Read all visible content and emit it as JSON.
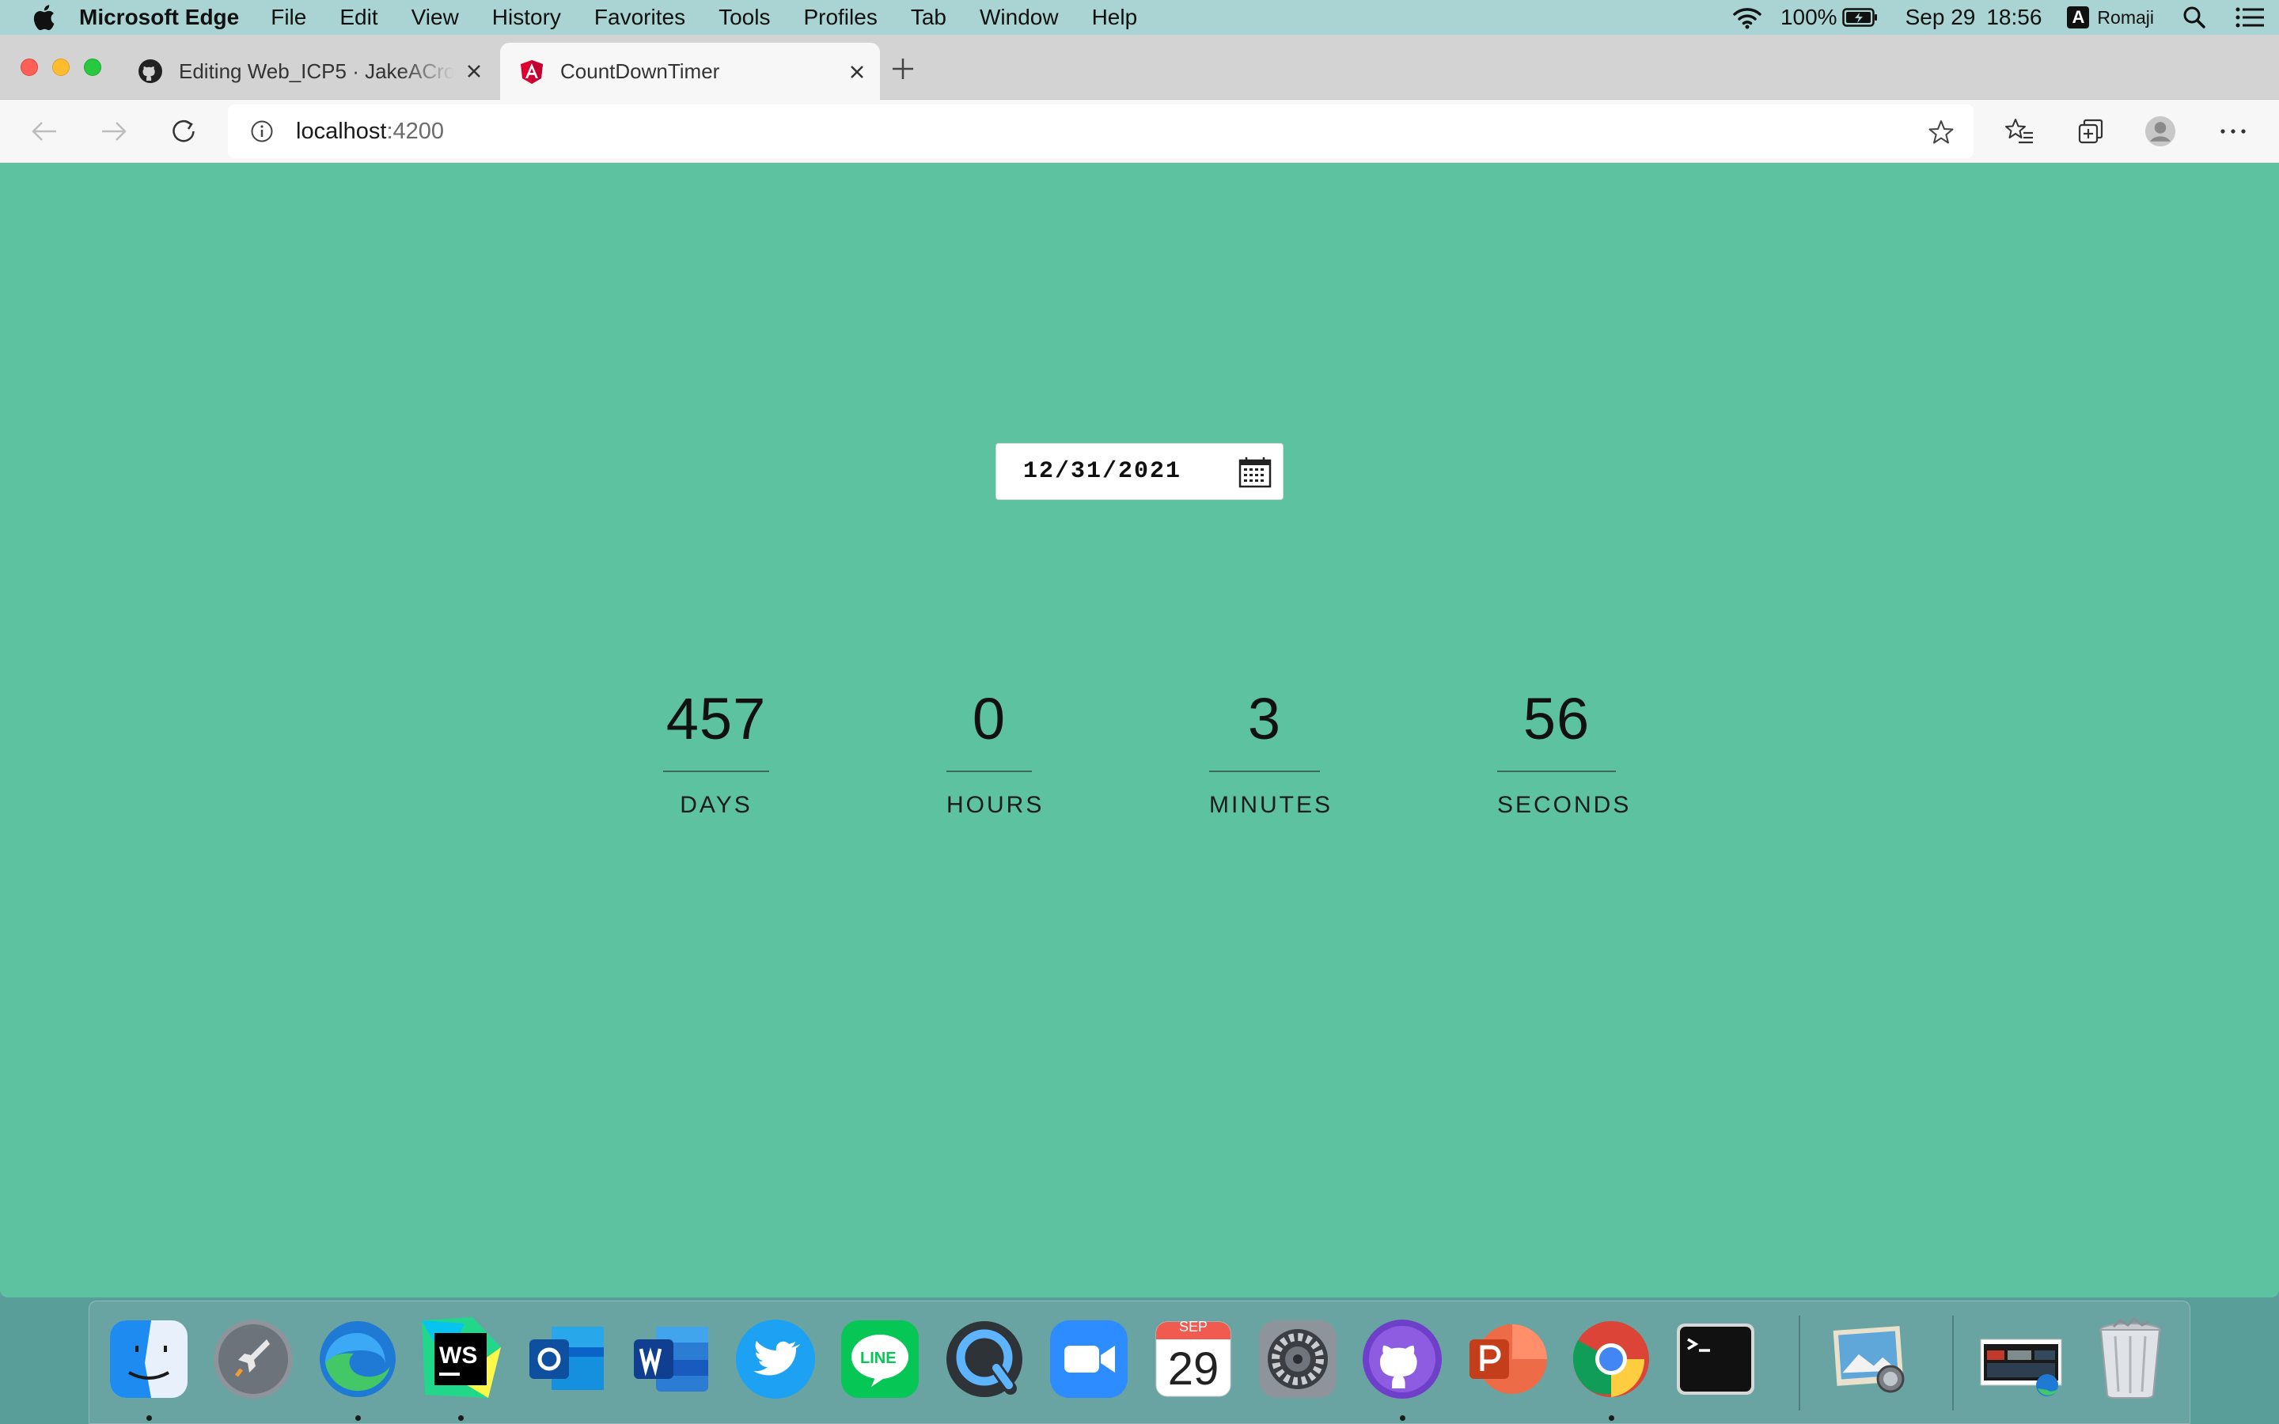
{
  "menubar": {
    "app_name": "Microsoft Edge",
    "items": [
      "File",
      "Edit",
      "View",
      "History",
      "Favorites",
      "Tools",
      "Profiles",
      "Tab",
      "Window",
      "Help"
    ],
    "battery": "100%",
    "date": "Sep 29",
    "time": "18:56",
    "input_badge": "A",
    "input_method": "Romaji"
  },
  "tabs": [
    {
      "title": "Editing Web_ICP5 · JakeACross",
      "icon": "github-icon",
      "active": false
    },
    {
      "title": "CountDownTimer",
      "icon": "angular-icon",
      "active": true
    }
  ],
  "address_bar": {
    "host": "localhost",
    "port": ":4200"
  },
  "page": {
    "date_value": "12/31/2021",
    "counters": [
      {
        "value": "457",
        "label": "DAYS"
      },
      {
        "value": "0",
        "label": "HOURS"
      },
      {
        "value": "3",
        "label": "MINUTES"
      },
      {
        "value": "56",
        "label": "SECONDS"
      }
    ]
  },
  "dock": {
    "calendar_month": "SEP",
    "calendar_day": "29",
    "apps": [
      "finder-icon",
      "launchpad-icon",
      "edge-icon",
      "webstorm-icon",
      "outlook-icon",
      "word-icon",
      "twitter-icon",
      "line-icon",
      "quicktime-icon",
      "zoom-icon",
      "calendar-icon",
      "system-preferences-icon",
      "github-desktop-icon",
      "powerpoint-icon",
      "chrome-icon",
      "terminal-icon",
      "preview-icon",
      "screenshot-icon",
      "trash-icon"
    ]
  },
  "colors": {
    "page_background": "#5cc29f",
    "menubar": "#a9d4d3"
  }
}
